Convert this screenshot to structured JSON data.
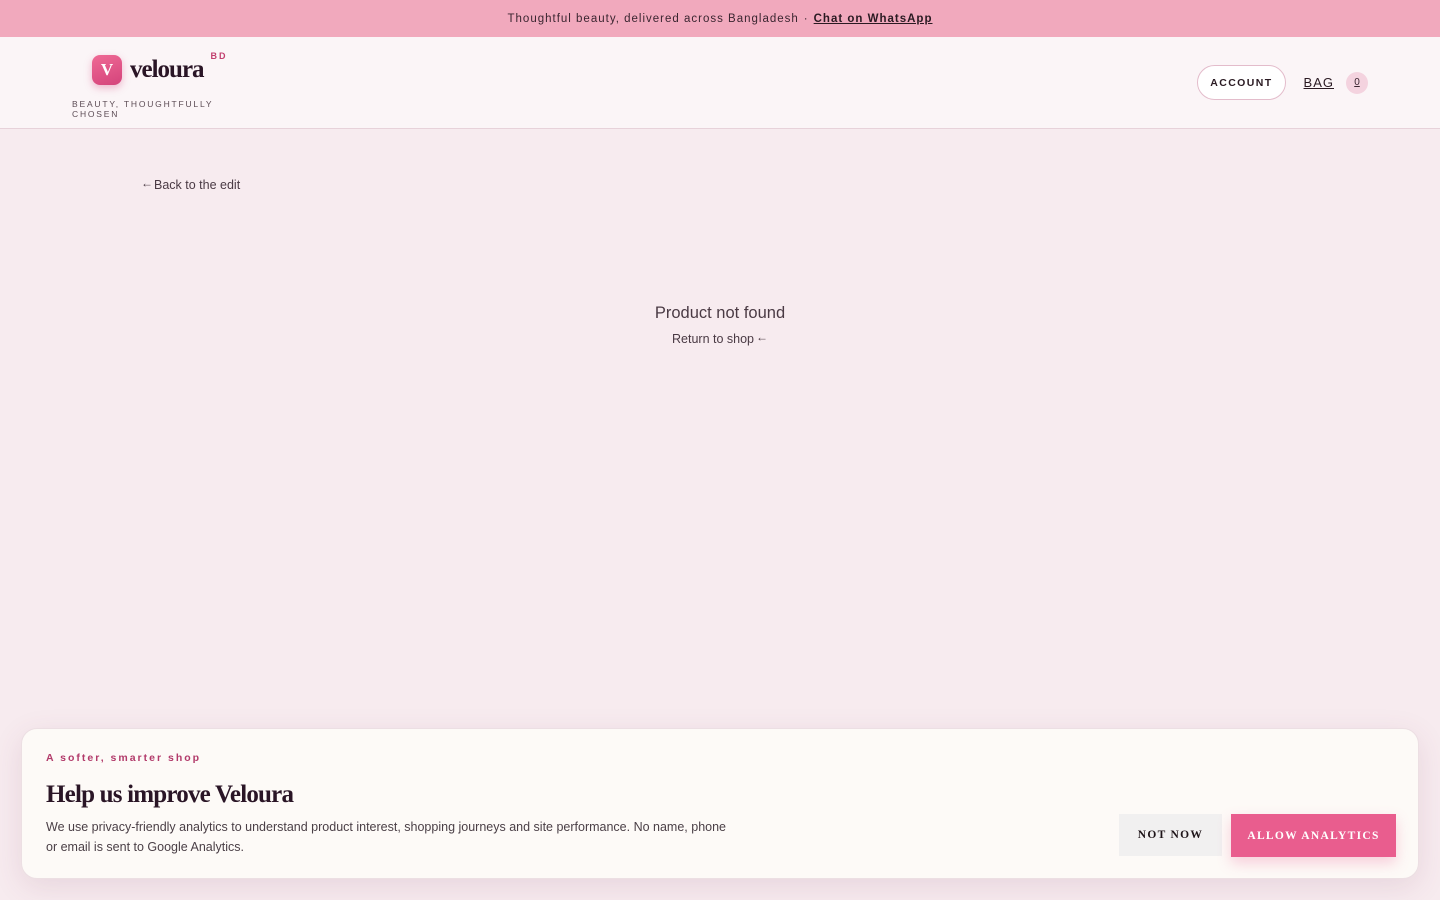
{
  "announcement": {
    "text": "Thoughtful beauty, delivered across Bangladesh",
    "separator": "·",
    "link_label": "Chat on WhatsApp"
  },
  "header": {
    "logo_letter": "V",
    "brand_name": "veloura",
    "region": "BD",
    "tagline": "BEAUTY, THOUGHTFULLY CHOSEN",
    "account_label": "ACCOUNT",
    "bag_label": "BAG",
    "bag_count": "0"
  },
  "main": {
    "back_arrow": "←",
    "back_label": "Back to the edit",
    "empty_title": "Product not found",
    "return_label": "Return to shop",
    "return_arrow": "←"
  },
  "consent": {
    "eyebrow": "A softer, smarter shop",
    "title": "Help us improve Veloura",
    "body": "We use privacy-friendly analytics to understand product interest, shopping journeys and site performance. No name, phone or email is sent to Google Analytics.",
    "decline_label": "NOT NOW",
    "accept_label": "ALLOW ANALYTICS"
  },
  "colors": {
    "announcement_bg": "#f1a9bd",
    "page_bg": "#f7ebef",
    "accent": "#e95d8e",
    "brand_text": "#2a1526"
  }
}
